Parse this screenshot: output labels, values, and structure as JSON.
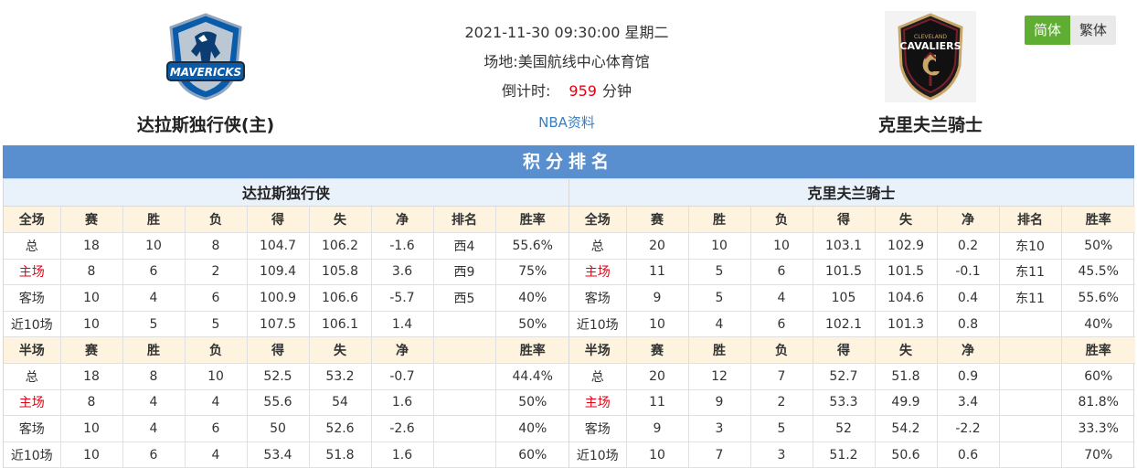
{
  "match": {
    "datetime": "2021-11-30 09:30:00 星期二",
    "venue_label": "场地:",
    "venue": "美国航线中心体育馆",
    "countdown_label": "倒计时:",
    "countdown_value": "959",
    "countdown_unit": "分钟",
    "nba_link": "NBA资料"
  },
  "home_team": {
    "name": "达拉斯独行侠(主)",
    "logo": "mavericks-logo"
  },
  "away_team": {
    "name": "克里夫兰骑士",
    "logo": "cavaliers-logo"
  },
  "lang": {
    "simplified": "简体",
    "traditional": "繁体"
  },
  "standings": {
    "title": "积分排名",
    "home": {
      "name": "达拉斯独行侠",
      "full_header": [
        "全场",
        "赛",
        "胜",
        "负",
        "得",
        "失",
        "净",
        "排名",
        "胜率"
      ],
      "full_rows": [
        [
          "总",
          "18",
          "10",
          "8",
          "104.7",
          "106.2",
          "-1.6",
          "西4",
          "55.6%"
        ],
        [
          "主场",
          "8",
          "6",
          "2",
          "109.4",
          "105.8",
          "3.6",
          "西9",
          "75%"
        ],
        [
          "客场",
          "10",
          "4",
          "6",
          "100.9",
          "106.6",
          "-5.7",
          "西5",
          "40%"
        ],
        [
          "近10场",
          "10",
          "5",
          "5",
          "107.5",
          "106.1",
          "1.4",
          "",
          "50%"
        ]
      ],
      "half_header": [
        "半场",
        "赛",
        "胜",
        "负",
        "得",
        "失",
        "净",
        "",
        "胜率"
      ],
      "half_rows": [
        [
          "总",
          "18",
          "8",
          "10",
          "52.5",
          "53.2",
          "-0.7",
          "",
          "44.4%"
        ],
        [
          "主场",
          "8",
          "4",
          "4",
          "55.6",
          "54",
          "1.6",
          "",
          "50%"
        ],
        [
          "客场",
          "10",
          "4",
          "6",
          "50",
          "52.6",
          "-2.6",
          "",
          "40%"
        ],
        [
          "近10场",
          "10",
          "6",
          "4",
          "53.4",
          "51.8",
          "1.6",
          "",
          "60%"
        ]
      ]
    },
    "away": {
      "name": "克里夫兰骑士",
      "full_header": [
        "全场",
        "赛",
        "胜",
        "负",
        "得",
        "失",
        "净",
        "排名",
        "胜率"
      ],
      "full_rows": [
        [
          "总",
          "20",
          "10",
          "10",
          "103.1",
          "102.9",
          "0.2",
          "东10",
          "50%"
        ],
        [
          "主场",
          "11",
          "5",
          "6",
          "101.5",
          "101.5",
          "-0.1",
          "东11",
          "45.5%"
        ],
        [
          "客场",
          "9",
          "5",
          "4",
          "105",
          "104.6",
          "0.4",
          "东11",
          "55.6%"
        ],
        [
          "近10场",
          "10",
          "4",
          "6",
          "102.1",
          "101.3",
          "0.8",
          "",
          "40%"
        ]
      ],
      "half_header": [
        "半场",
        "赛",
        "胜",
        "负",
        "得",
        "失",
        "净",
        "",
        "胜率"
      ],
      "half_rows": [
        [
          "总",
          "20",
          "12",
          "7",
          "52.7",
          "51.8",
          "0.9",
          "",
          "60%"
        ],
        [
          "主场",
          "11",
          "9",
          "2",
          "53.3",
          "49.9",
          "3.4",
          "",
          "81.8%"
        ],
        [
          "客场",
          "9",
          "3",
          "5",
          "52",
          "54.2",
          "-2.2",
          "",
          "33.3%"
        ],
        [
          "近10场",
          "10",
          "7",
          "3",
          "51.2",
          "50.6",
          "0.6",
          "",
          "70%"
        ]
      ]
    }
  },
  "colors": {
    "header_blue": "#5a8fcf",
    "accent_red": "#e60012",
    "lang_green": "#5fae33",
    "link_blue": "#3a7fc1"
  }
}
